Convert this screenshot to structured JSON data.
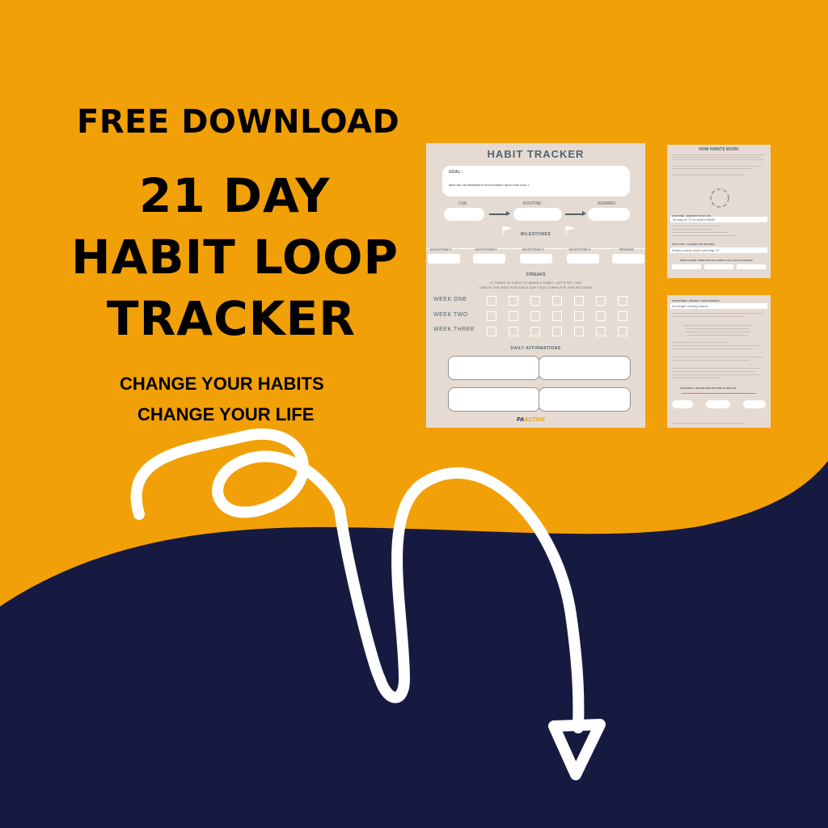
{
  "colors": {
    "orange": "#f2a007",
    "navy": "#171a40",
    "sheet": "#e6dbd3",
    "sheet_text": "#4f6470",
    "arrow": "#ffffff"
  },
  "hero": {
    "pre": "FREE DOWNLOAD",
    "line1": "21 DAY",
    "line2": "HABIT LOOP",
    "line3": "TRACKER",
    "tag1": "CHANGE YOUR HABITS",
    "tag2": "CHANGE YOUR LIFE"
  },
  "tracker": {
    "title": "HABIT TRACKER",
    "goal_label": "GOAL :",
    "goal_question": "WHAT WILL BE DIFFERENT IN 60 DAYS WHEN I REACH THIS GOAL ?",
    "flow": [
      "CUE",
      "ROUTINE",
      "REWARD"
    ],
    "milestones_title": "MILESTONES",
    "milestones": [
      "MILESTONE 1",
      "MILESTONE 2",
      "MILESTONE 3",
      "MILESTONE 4",
      "REWARD"
    ],
    "streaks_title": "STREAKS",
    "streaks_sub1": "IT TAKES 21 DAYS TO MAKE A HABIT, LET'S DO THIS",
    "streaks_sub2": "CHECK THE BOX FOR EACH DAY YOU COMPLETE THE ROUTINE",
    "weeks": [
      "WEEK ONE",
      "WEEK TWO",
      "WEEK THREE"
    ],
    "affirmations_title": "DAILY AFFIRMATIONS",
    "logo_a": "PA",
    "logo_b": "ACTIVE"
  },
  "how_habits": {
    "title": "HOW HABITS WORK",
    "step1": "STEP ONE : IDENTIFY YOUR CUE",
    "cue_value": "Turning on TV to watch Netflix",
    "step2": "STEP TWO : CHANGE THE ROUTINE",
    "routine_value": "Eating snacks while watching TV",
    "write_label": "WRITE DOWN THREE BETTER HABITS YOU CAN DO INSTEAD"
  },
  "reward_sheet": {
    "step3": "STEP THREE : IDENTIFY YOUR REWARD",
    "reward_value": "No longer craving snacks",
    "formula": "CREATING A BRAND NEW ROUTINE IS SIMILAR"
  }
}
